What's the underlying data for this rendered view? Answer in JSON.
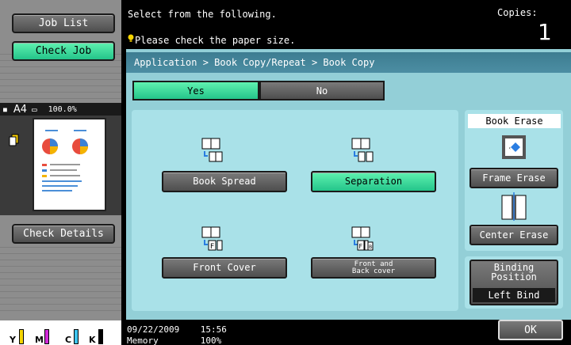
{
  "left_panel": {
    "job_list_label": "Job List",
    "check_job_label": "Check Job",
    "check_details_label": "Check Details",
    "paper_size": "A4",
    "zoom": "100.0%",
    "toner": [
      "Y",
      "M",
      "C",
      "K"
    ]
  },
  "header": {
    "message": "Select from the following.",
    "warning": "Please check the paper size.",
    "copies_label": "Copies:",
    "copies_value": "1"
  },
  "breadcrumb": "Application > Book Copy/Repeat > Book Copy",
  "toggle": {
    "yes_label": "Yes",
    "no_label": "No",
    "selected": "Yes"
  },
  "options": {
    "book_spread": "Book Spread",
    "separation": "Separation",
    "front_cover": "Front Cover",
    "front_back_line1": "Front and",
    "front_back_line2": "Back cover",
    "selected": "Separation"
  },
  "book_erase": {
    "title": "Book Erase",
    "frame_erase": "Frame Erase",
    "center_erase": "Center Erase"
  },
  "binding": {
    "label_line1": "Binding",
    "label_line2": "Position",
    "value": "Left Bind"
  },
  "footer": {
    "datetime": "09/22/2009    15:56",
    "memory": "Memory        100%",
    "ok_label": "OK"
  },
  "colors": {
    "accent_green": "#3ddc9b",
    "panel_blue": "#93cfd7",
    "breadcrumb_blue": "#4c8ea3"
  }
}
